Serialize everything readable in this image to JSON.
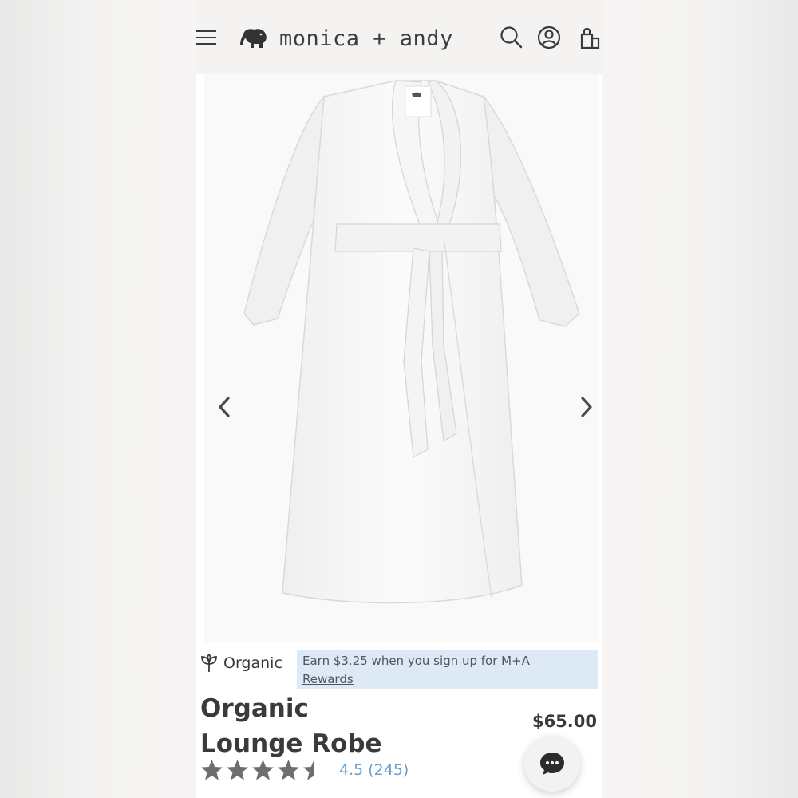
{
  "header": {
    "brand": "monica + andy",
    "icons": [
      "menu-icon",
      "elephant-logo-icon",
      "search-icon",
      "account-icon",
      "bag-icon"
    ]
  },
  "gallery": {
    "image_alt": "Organic Lounge Robe",
    "prev_icon": "chevron-left-icon",
    "next_icon": "chevron-right-icon"
  },
  "badge": {
    "label": "Organic",
    "icon": "sprout-icon"
  },
  "rewards": {
    "prefix": "Earn $3.25 when you ",
    "link_line1": "sign up for M+A",
    "link_line2": "Rewards",
    "background": "#dde9f5"
  },
  "product": {
    "title_line1": "Organic",
    "title_line2": "Lounge Robe",
    "price": "$65.00",
    "rating": 4.5,
    "rating_text": "4.5 (245)",
    "stars_total": 5
  },
  "chat": {
    "icon": "chat-bubble-icon"
  },
  "colors": {
    "text": "#3a3a3a",
    "link": "#6a9fcf",
    "star": "#6e6e6e",
    "header_bg": "#f5f3f1"
  }
}
